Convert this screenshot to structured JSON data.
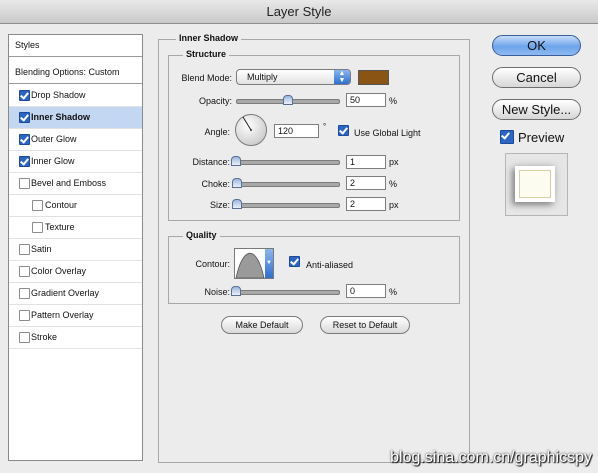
{
  "window": {
    "title": "Layer Style"
  },
  "sidebar": {
    "styles_label": "Styles",
    "blending_label": "Blending Options: Custom",
    "items": [
      {
        "label": "Drop Shadow",
        "checked": true
      },
      {
        "label": "Inner Shadow",
        "checked": true,
        "selected": true
      },
      {
        "label": "Outer Glow",
        "checked": true
      },
      {
        "label": "Inner Glow",
        "checked": true
      },
      {
        "label": "Bevel and Emboss",
        "checked": false
      },
      {
        "label": "Contour",
        "checked": false,
        "indent": true
      },
      {
        "label": "Texture",
        "checked": false,
        "indent": true
      },
      {
        "label": "Satin",
        "checked": false
      },
      {
        "label": "Color Overlay",
        "checked": false
      },
      {
        "label": "Gradient Overlay",
        "checked": false
      },
      {
        "label": "Pattern Overlay",
        "checked": false
      },
      {
        "label": "Stroke",
        "checked": false
      }
    ]
  },
  "panel": {
    "title": "Inner Shadow",
    "structure": {
      "title": "Structure",
      "blend_mode_label": "Blend Mode:",
      "blend_mode_value": "Multiply",
      "color_swatch": "#8a5414",
      "opacity_label": "Opacity:",
      "opacity_value": "50",
      "opacity_unit": "%",
      "opacity_slider": 0.5,
      "angle_label": "Angle:",
      "angle_value": "120",
      "angle_unit": "°",
      "use_global_light_label": "Use Global Light",
      "use_global_light": true,
      "distance_label": "Distance:",
      "distance_value": "1",
      "distance_unit": "px",
      "choke_label": "Choke:",
      "choke_value": "2",
      "choke_unit": "%",
      "size_label": "Size:",
      "size_value": "2",
      "size_unit": "px"
    },
    "quality": {
      "title": "Quality",
      "contour_label": "Contour:",
      "anti_aliased_label": "Anti-aliased",
      "anti_aliased": true,
      "noise_label": "Noise:",
      "noise_value": "0",
      "noise_unit": "%"
    },
    "make_default_label": "Make Default",
    "reset_default_label": "Reset to Default"
  },
  "buttons": {
    "ok": "OK",
    "cancel": "Cancel",
    "new_style": "New Style...",
    "preview_label": "Preview",
    "preview_checked": true
  },
  "watermark": "blog.sina.com.cn/graphicspy"
}
